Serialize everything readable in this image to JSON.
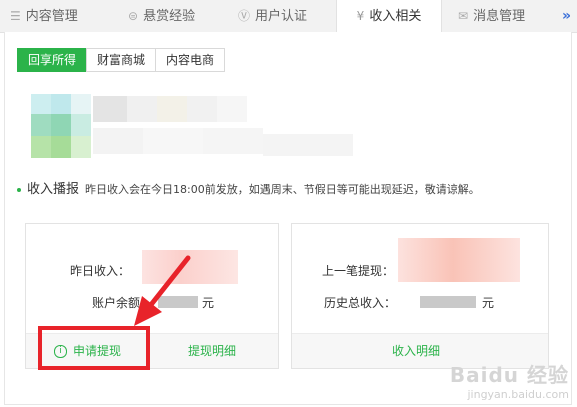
{
  "tabs": [
    {
      "label": "内容管理",
      "icon": "list-icon"
    },
    {
      "label": "悬赏经验",
      "icon": "coin-icon"
    },
    {
      "label": "用户认证",
      "icon": "verify-v-icon"
    },
    {
      "label": "收入相关",
      "icon": "yen-icon",
      "active": true
    },
    {
      "label": "消息管理",
      "icon": "mail-icon"
    }
  ],
  "more_label": "»",
  "subtabs": [
    {
      "label": "回享所得",
      "active": true
    },
    {
      "label": "财富商城"
    },
    {
      "label": "内容电商"
    }
  ],
  "notice": {
    "title": "收入播报",
    "text": "昨日收入会在今日18:00前发放，如遇周末、节假日等可能出现延迟，敬请谅解。"
  },
  "card_left": {
    "row1_label": "昨日收入：",
    "row2_label": "账户余额：",
    "row2_unit": "元",
    "apply_icon": "i",
    "apply_label": "申请提现",
    "detail_label": "提现明细"
  },
  "card_right": {
    "row1_label": "上一笔提现：",
    "row2_label": "历史总收入：",
    "row2_unit": "元",
    "detail_label": "收入明细"
  },
  "watermark": {
    "brand": "Baidu 经验",
    "url": "jingyan.baidu.com"
  },
  "colors": {
    "accent": "#2bb34a",
    "annotation": "#e8232a",
    "link_blue": "#3a6fd8"
  }
}
